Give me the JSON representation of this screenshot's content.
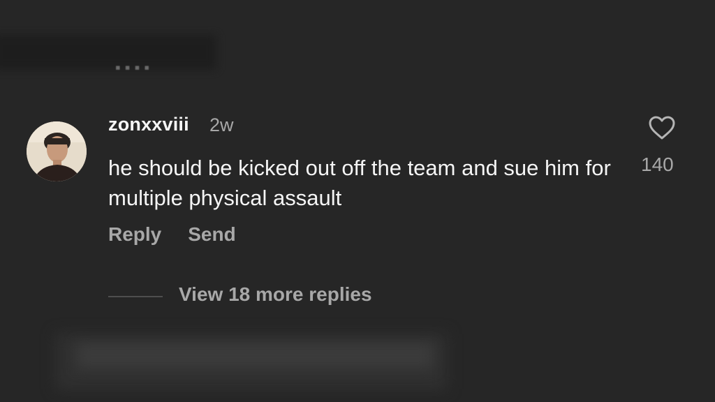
{
  "comment": {
    "username": "zonxxviii",
    "timestamp": "2w",
    "text": "he should be kicked out off the team and sue him for multiple physical assault",
    "like_count": "140",
    "reply_label": "Reply",
    "send_label": "Send"
  },
  "replies": {
    "view_more_label": "View 18 more replies"
  },
  "icons": {
    "like": "heart-outline-icon"
  },
  "colors": {
    "background": "#262626",
    "primary_text": "#f5f5f5",
    "secondary_text": "#a8a8a8"
  }
}
